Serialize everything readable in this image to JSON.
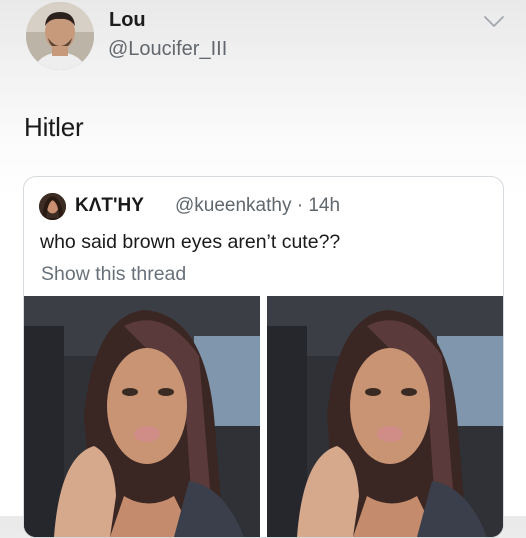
{
  "tweet": {
    "author_name": "Lou",
    "author_handle": "@Loucifer_III",
    "text": "Hitler",
    "menu_icon": "chevron-down-icon"
  },
  "quoted_tweet": {
    "author_name": "KΛT'HY",
    "author_handle": "@kueenkathy",
    "time": "14h",
    "meta": "@kueenkathy · 14h",
    "text": "who said brown eyes aren’t cute??",
    "show_thread_label": "Show this thread",
    "photos": [
      "selfie-photo-1",
      "selfie-photo-2"
    ]
  },
  "colors": {
    "name": "#1c1c1c",
    "secondary": "#62686e",
    "border": "#d6dbdf"
  }
}
